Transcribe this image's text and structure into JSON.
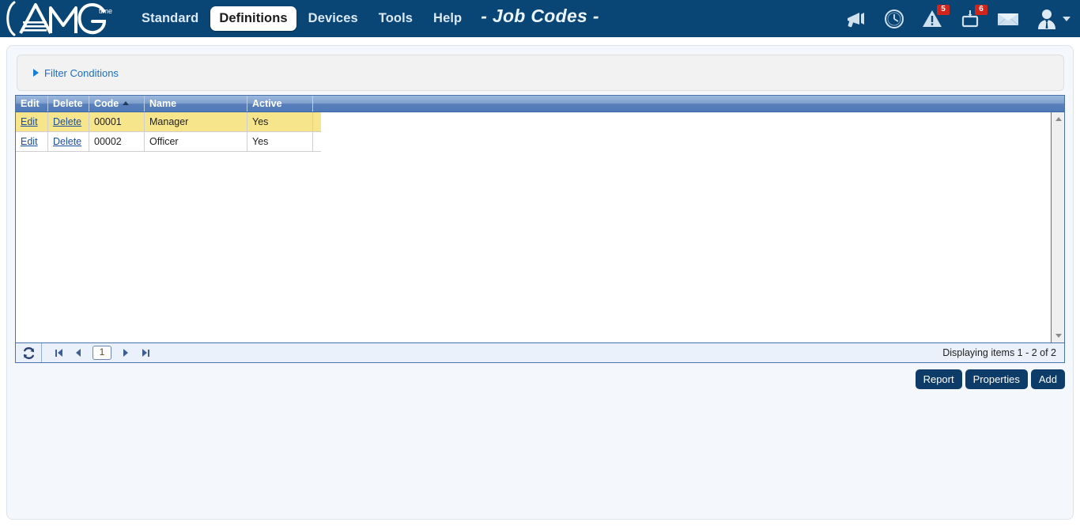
{
  "header": {
    "logo_alt": "AMG Time",
    "logo_text": "AMG",
    "logo_superscript": "time",
    "title": "- Job Codes -",
    "nav": [
      {
        "label": "Standard",
        "active": false
      },
      {
        "label": "Definitions",
        "active": true
      },
      {
        "label": "Devices",
        "active": false
      },
      {
        "label": "Tools",
        "active": false
      },
      {
        "label": "Help",
        "active": false
      }
    ],
    "tools": [
      {
        "icon": "megaphone-icon",
        "badge": ""
      },
      {
        "icon": "clock-icon",
        "badge": ""
      },
      {
        "icon": "warning-triangle-icon",
        "badge": "5"
      },
      {
        "icon": "time-clock-device-icon",
        "badge": "6"
      },
      {
        "icon": "envelope-icon",
        "badge": ""
      }
    ],
    "user_menu": {
      "icon": "user-avatar-icon",
      "caret": "chevron-down-icon"
    }
  },
  "filter": {
    "label": "Filter Conditions",
    "expanded": false
  },
  "grid": {
    "columns": [
      {
        "key": "edit",
        "label": "Edit",
        "sorted": ""
      },
      {
        "key": "delete",
        "label": "Delete",
        "sorted": ""
      },
      {
        "key": "code",
        "label": "Code",
        "sorted": "asc"
      },
      {
        "key": "name",
        "label": "Name",
        "sorted": ""
      },
      {
        "key": "active",
        "label": "Active",
        "sorted": ""
      }
    ],
    "rows": [
      {
        "edit": "Edit",
        "delete": "Delete",
        "code": "00001",
        "name": "Manager",
        "active": "Yes",
        "selected": true
      },
      {
        "edit": "Edit",
        "delete": "Delete",
        "code": "00002",
        "name": "Officer",
        "active": "Yes",
        "selected": false
      }
    ]
  },
  "pager": {
    "refresh_icon": "refresh-icon",
    "first_label": "First page",
    "prev_label": "Previous page",
    "current_page": "1",
    "next_label": "Next page",
    "last_label": "Last page",
    "status": "Displaying items 1 - 2 of 2"
  },
  "actions": [
    {
      "label": "Report"
    },
    {
      "label": "Properties"
    },
    {
      "label": "Add"
    }
  ],
  "colors": {
    "header_bg": "#0a4675",
    "panel_bg": "#f4f8fd",
    "grid_header_blue": "#5a80bb",
    "selected_row": "#f7e58c",
    "badge_red": "#d0251c",
    "link_blue": "#1b4f9c",
    "button_navy": "#0d3c68"
  }
}
